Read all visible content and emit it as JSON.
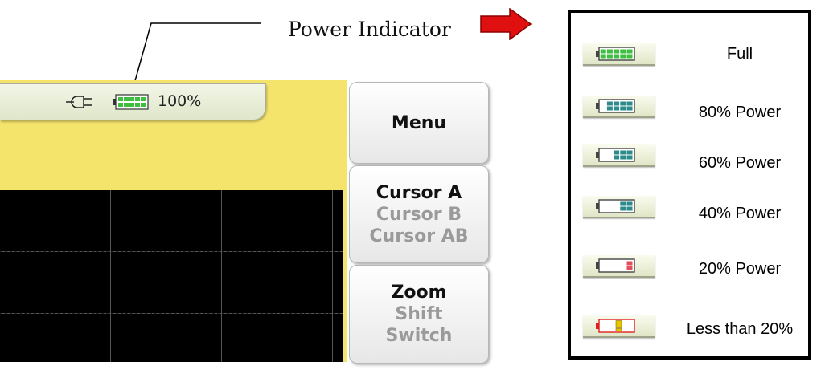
{
  "annotation": {
    "label": "Power Indicator"
  },
  "status_bar": {
    "power_source_icon": "ac-plug-icon",
    "battery_icon": "battery-full-icon",
    "battery_percent": "100%",
    "battery_level": 1.0
  },
  "soft_keys": {
    "menu": {
      "label": "Menu"
    },
    "cursor": {
      "options": [
        "Cursor A",
        "Cursor B",
        "Cursor AB"
      ],
      "selected": "Cursor A"
    },
    "zoom": {
      "options": [
        "Zoom",
        "Shift",
        "Switch"
      ],
      "selected": "Zoom"
    }
  },
  "legend": {
    "items": [
      {
        "label": "Full",
        "level": 1.0,
        "fill_color": "#3fbf3f",
        "icon": "battery-full-icon"
      },
      {
        "label": "80% Power",
        "level": 0.8,
        "fill_color": "#2e8b8b",
        "icon": "battery-80-icon"
      },
      {
        "label": "60% Power",
        "level": 0.6,
        "fill_color": "#2e8b8b",
        "icon": "battery-60-icon"
      },
      {
        "label": "40% Power",
        "level": 0.4,
        "fill_color": "#2e8b8b",
        "icon": "battery-40-icon"
      },
      {
        "label": "20% Power",
        "level": 0.2,
        "fill_color": "#e0505a",
        "icon": "battery-20-icon"
      },
      {
        "label": "Less than 20%",
        "level": 0.0,
        "fill_color": "#e8c400",
        "outline_color": "#e02020",
        "icon": "battery-low-warning-icon"
      }
    ]
  },
  "colors": {
    "screen_background": "#f4e46c",
    "waveform_background": "#000000",
    "arrow": "#e01010"
  }
}
